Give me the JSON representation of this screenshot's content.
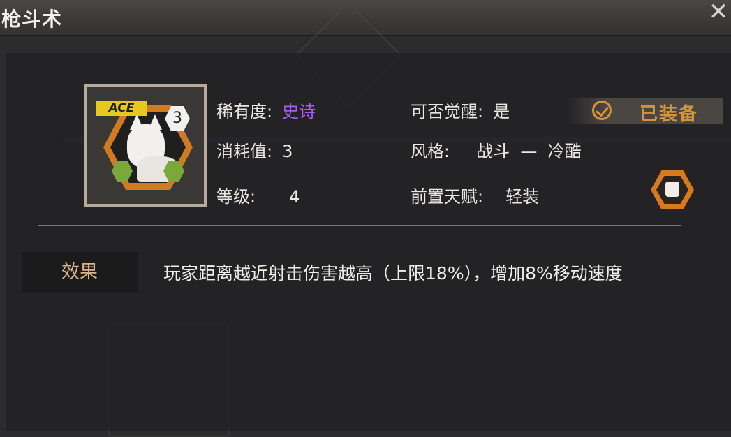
{
  "window": {
    "title": "枪斗术",
    "close_icon": "close-icon"
  },
  "card": {
    "badge": "ACE",
    "level_badge": "3",
    "colors": {
      "frame": "#b5aa9c",
      "hex": "#d07a22",
      "ace": "#e6c81e",
      "slot": "#7aa83a"
    }
  },
  "attributes": {
    "rarity": {
      "label": "稀有度:",
      "value": "史诗",
      "color": "#a45cf2"
    },
    "cost": {
      "label": "消耗值:",
      "value": "3"
    },
    "level": {
      "label": "等级:",
      "value": "4"
    },
    "awaken": {
      "label": "可否觉醒:",
      "value": "是"
    },
    "style": {
      "label": "风格:",
      "value": "战斗  —  冷酷"
    },
    "prereq": {
      "label": "前置天赋:",
      "value": "轻装"
    }
  },
  "status": {
    "equipped_label": "已装备",
    "color": "#d6943a"
  },
  "effect": {
    "tab_label": "效果",
    "text": "玩家距离越近射击伤害越高（上限18%），增加8%移动速度"
  }
}
